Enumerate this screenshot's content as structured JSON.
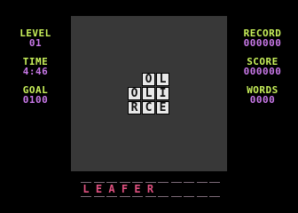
{
  "stats_left": [
    {
      "label": "LEVEL",
      "value": "01"
    },
    {
      "label": "TIME",
      "value": "4:46"
    },
    {
      "label": "GOAL",
      "value": "0100"
    }
  ],
  "stats_right": [
    {
      "label": "RECORD",
      "value": "000000"
    },
    {
      "label": "SCORE",
      "value": "000000"
    },
    {
      "label": "WORDS",
      "value": "0000"
    }
  ],
  "board": {
    "rows": [
      [
        "",
        "O",
        "L"
      ],
      [
        "O",
        "L",
        "I"
      ],
      [
        "R",
        "C",
        "E"
      ]
    ]
  },
  "current_word": {
    "letters": [
      "L",
      "E",
      "A",
      "F",
      "E",
      "R",
      "",
      "",
      "",
      "",
      ""
    ]
  },
  "colors": {
    "label": "#c8f05a",
    "value": "#c878e8",
    "board": "#383838",
    "word": "#e05080"
  }
}
